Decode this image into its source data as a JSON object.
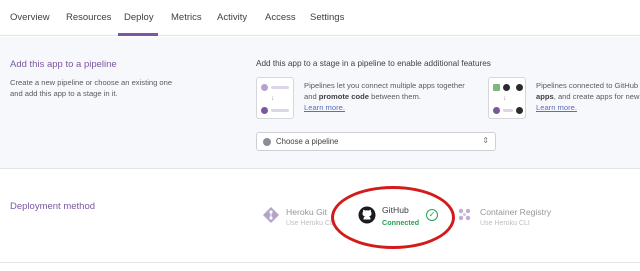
{
  "tabs": [
    {
      "label": "Overview"
    },
    {
      "label": "Resources"
    },
    {
      "label": "Deploy"
    },
    {
      "label": "Metrics"
    },
    {
      "label": "Activity"
    },
    {
      "label": "Access"
    },
    {
      "label": "Settings"
    }
  ],
  "active_tab": "Deploy",
  "pipeline": {
    "title": "Add this app to a pipeline",
    "description": "Create a new pipeline or choose an existing one and add this app to a stage in it.",
    "heading": "Add this app to a stage in a pipeline to enable additional features",
    "feature1": {
      "text_a": "Pipelines let you connect multiple apps together and ",
      "bold": "promote code",
      "text_b": " between them.",
      "link": "Learn more."
    },
    "feature2": {
      "text_a": "Pipelines connected to GitHub",
      "bold": "apps",
      "text_b": ", and create apps for new",
      "link": "Learn more."
    },
    "select_placeholder": "Choose a pipeline"
  },
  "deployment": {
    "title": "Deployment method",
    "methods": [
      {
        "name": "Heroku Git",
        "sub": "Use Heroku CLI",
        "icon": "heroku-git-icon"
      },
      {
        "name": "GitHub",
        "status": "Connected",
        "icon": "github-icon"
      },
      {
        "name": "Container Registry",
        "sub": "Use Heroku CLI",
        "icon": "container-registry-icon"
      }
    ]
  },
  "colors": {
    "accent": "#79589f",
    "connected": "#2aa156",
    "highlight_ring": "#d41b1b"
  }
}
